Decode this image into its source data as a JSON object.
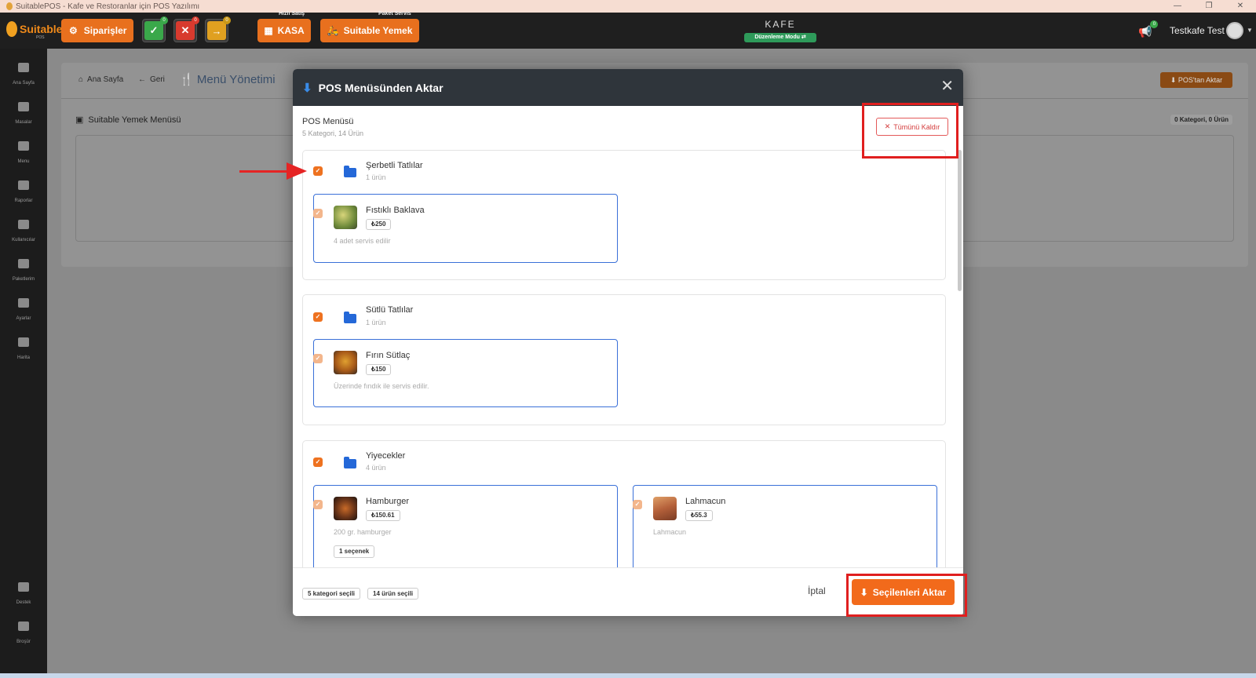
{
  "window": {
    "title": "SuitablePOS - Kafe ve Restoranlar için POS Yazılımı",
    "controls": [
      "—",
      "❐",
      "✕"
    ]
  },
  "appbar": {
    "logo_text": "Suitable",
    "logo_sub": "POS",
    "orders_label": "Siparişler",
    "quick": [
      {
        "symbol": "✓",
        "badge": "0",
        "color": "#3aa84a",
        "badge_color": "#3aa84a"
      },
      {
        "symbol": "✕",
        "badge": "0",
        "color": "#d83a2e",
        "badge_color": "#d83a2e"
      },
      {
        "symbol": "→",
        "badge": "0",
        "color": "#e0a020",
        "badge_color": "#c99818"
      }
    ],
    "kasa_caption": "Hızlı Satış",
    "kasa_label": "KASA",
    "yemek_caption": "Paket Servis",
    "yemek_label": "Suitable Yemek",
    "venue": "KAFE",
    "mode": "Düzenleme Modu",
    "announce_badge": "0",
    "user_name": "Testkafe Test"
  },
  "sidebar": {
    "top": [
      {
        "label": "Ana Sayfa",
        "icon": "home-icon"
      },
      {
        "label": "Masalar",
        "icon": "table-icon"
      },
      {
        "label": "Menu",
        "icon": "utensils-icon"
      },
      {
        "label": "Raporlar",
        "icon": "report-icon"
      },
      {
        "label": "Kullanıcılar",
        "icon": "users-icon"
      },
      {
        "label": "Paketlerim",
        "icon": "gift-icon"
      },
      {
        "label": "Ayarlar",
        "icon": "gears-icon"
      },
      {
        "label": "Harita",
        "icon": "map-icon"
      }
    ],
    "bottom": [
      {
        "label": "Destek",
        "icon": "chat-icon"
      },
      {
        "label": "Broşür",
        "icon": "brochure-icon"
      }
    ]
  },
  "background_page": {
    "crumb_home": "Ana Sayfa",
    "crumb_back": "Geri",
    "title": "Menü Yönetimi",
    "export_button": "POS'tan Aktar",
    "yemek_menu_title": "Suitable Yemek Menüsü",
    "counts": "0 Kategori, 0 Ürün"
  },
  "modal": {
    "title": "POS Menüsünden Aktar",
    "source_title": "POS Menüsü",
    "source_sub": "5 Kategori, 14 Ürün",
    "remove_all": "Tümünü Kaldır",
    "categories": [
      {
        "name": "Şerbetli Tatlılar",
        "count": "1 ürün",
        "products": [
          {
            "name": "Fıstıklı Baklava",
            "price": "₺250",
            "desc": "4 adet servis edilir",
            "option": ""
          }
        ]
      },
      {
        "name": "Sütlü Tatlılar",
        "count": "1 ürün",
        "products": [
          {
            "name": "Fırın Sütlaç",
            "price": "₺150",
            "desc": "Üzerinde fındık ile servis edilir.",
            "option": ""
          }
        ]
      },
      {
        "name": "Yiyecekler",
        "count": "4 ürün",
        "products": [
          {
            "name": "Hamburger",
            "price": "₺150.61",
            "desc": "200 gr. hamburger",
            "option": "1 seçenek"
          },
          {
            "name": "Lahmacun",
            "price": "₺55.3",
            "desc": "Lahmacun",
            "option": ""
          }
        ]
      }
    ],
    "selected_categories": "5 kategori seçili",
    "selected_products": "14 ürün seçili",
    "cancel": "İptal",
    "import": "Seçilenleri Aktar"
  },
  "colors": {
    "accent": "#f26a1b",
    "folder": "#2468d8",
    "annotation": "#e01f1f",
    "header": "#2f353b"
  }
}
